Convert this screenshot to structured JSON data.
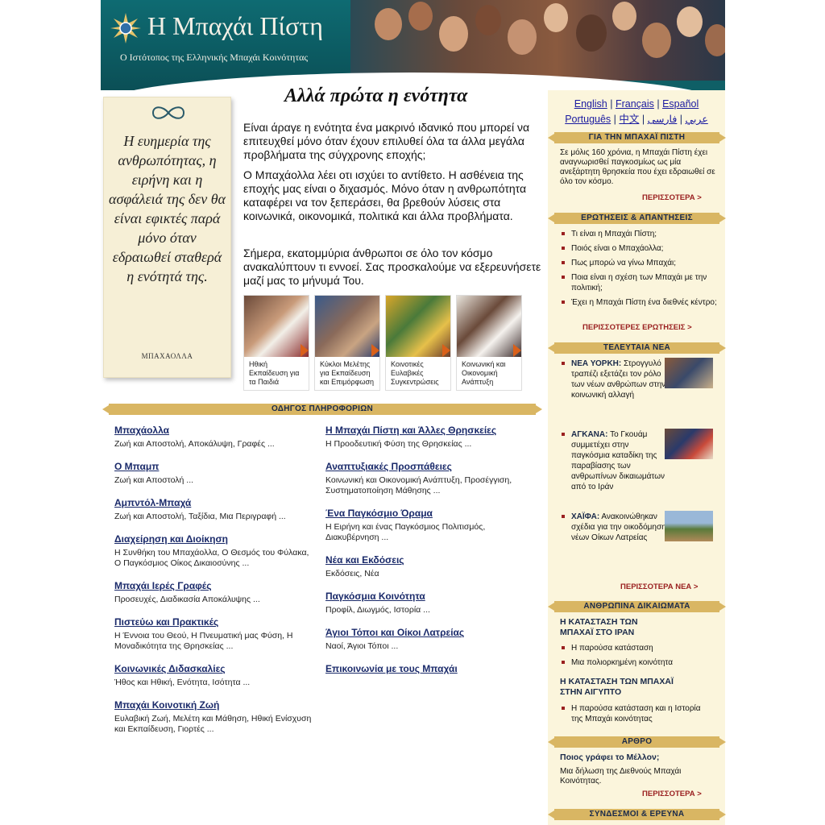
{
  "header": {
    "title": "Η Μπαχάι Πίστη",
    "subtitle": "Ο Ιστότοπος της Ελληνικής Μπαχάι Κοινότητας"
  },
  "quote": {
    "text": "Η ευημερία της ανθρωπότητας, η ειρήνη και η ασφάλειά της δεν θα είναι εφικτές παρά μόνο όταν εδραιωθεί σταθερά η ενότητά της.",
    "author": "ΜΠΑΧΑΟΛΛΑ"
  },
  "main": {
    "title": "Αλλά πρώτα η ενότητα",
    "paragraphs": [
      "Είναι άραγε η ενότητα ένα μακρινό ιδανικό που μπορεί να επιτευχθεί μόνο όταν έχουν επιλυθεί όλα τα άλλα μεγάλα προβλήματα της σύγχρονης εποχής;",
      "Ο Μπαχάολλα λέει οτι ισχύει το αντίθετο. Η ασθένεια της εποχής μας είναι ο διχασμός. Μόνο όταν η ανθρωπότητα καταφέρει να τον ξεπεράσει, θα βρεθούν λύσεις στα κοινωνικά, οικονομικά, πολιτικά και άλλα προβλήματα.",
      "Σήμερα, εκατομμύρια άνθρωποι σε όλο τον κόσμο ανακαλύπτουν τι εννοεί. Σας προσκαλούμε να εξερευνήσετε μαζί μας το μήνυμά Του."
    ],
    "thumbs": [
      {
        "caption": "Ηθική Εκπαίδευση για τα Παιδιά"
      },
      {
        "caption": "Κύκλοι Μελέτης για Εκπαίδευση και Επιμόρφωση"
      },
      {
        "caption": "Κοινοτικές Ευλαβικές Συγκεντρώσεις"
      },
      {
        "caption": "Κοινωνική και Οικονομική Ανάπτυξη"
      }
    ]
  },
  "guide": {
    "bar": "ΟΔΗΓΟΣ ΠΛΗΡΟΦΟΡΙΩΝ",
    "left": [
      {
        "title": "Μπαχάολλα",
        "desc": "Ζωή και Αποστολή, Αποκάλυψη, Γραφές ..."
      },
      {
        "title": "Ο Μπαμπ",
        "desc": "Ζωή και Αποστολή ..."
      },
      {
        "title": "Αμπντόλ-Μπαχά",
        "desc": "Ζωή και Αποστολή, Ταξίδια, Μια Περιγραφή ..."
      },
      {
        "title": "Διαχείρηση και Διοίκηση",
        "desc": "Η Συνθήκη του Μπαχάολλα, Ο Θεσμός του Φύλακα, Ο Παγκόσμιος Οίκος Δικαιοσύνης ..."
      },
      {
        "title": "Μπαχάι Ιερές Γραφές",
        "desc": "Προσευχές, Διαδικασία Αποκάλυψης ..."
      },
      {
        "title": "Πιστεύω και Πρακτικές",
        "desc": "Η Έννοια του Θεού, Η Πνευματική μας Φύση, Η Μοναδικότητα της Θρησκείας ..."
      },
      {
        "title": "Κοινωνικές Διδασκαλίες",
        "desc": "Ήθος και Ηθική, Ενότητα, Ισότητα ..."
      },
      {
        "title": "Μπαχάι Κοινοτική Ζωή",
        "desc": "Ευλαβική Ζωή, Μελέτη και Μάθηση, Ηθική Ενίσχυση και Εκπαίδευση, Γιορτές ..."
      }
    ],
    "right": [
      {
        "title": "Η Μπαχάι Πίστη και Άλλες Θρησκείες",
        "desc": "Η Προοδευτική Φύση της Θρησκείας ..."
      },
      {
        "title": "Αναπτυξιακές Προσπάθειες",
        "desc": "Κοινωνική και Οικονομική Ανάπτυξη, Προσέγγιση, Συστηματοποίηση Μάθησης ..."
      },
      {
        "title": "Ένα Παγκόσμιο Όραμα",
        "desc": "Η Ειρήνη και ένας Παγκόσμιος Πολιτισμός, Διακυβέρνηση ..."
      },
      {
        "title": "Νέα και Εκδόσεις",
        "desc": "Εκδόσεις, Νέα"
      },
      {
        "title": "Παγκόσμια Κοινότητα",
        "desc": "Προφίλ, Διωγμός, Ιστορία ..."
      },
      {
        "title": "Άγιοι Τόποι και Οίκοι Λατρείας",
        "desc": "Ναοί, Άγιοι Τόποι ..."
      },
      {
        "title": "Επικοινωνία με τους Μπαχάι",
        "desc": ""
      }
    ]
  },
  "sidebar": {
    "languages": [
      "English",
      "Français",
      "Español",
      "Português",
      "中文",
      "عربي",
      "فارسی"
    ],
    "about": {
      "bar": "ΓΙΑ ΤΗΝ ΜΠΑΧΑΪ ΠΙΣΤΗ",
      "text": "Σε μόλις 160 χρόνια, η Μπαχάι Πίστη έχει αναγνωρισθεί παγκοσμίως ως μία ανεξάρτητη θρησκεία που έχει εδραιωθεί σε όλο τον κόσμο.",
      "more": "ΠΕΡΙΣΣΟΤΕΡΑ >"
    },
    "faq": {
      "bar": "ΕΡΩΤΗΣΕΙΣ & ΑΠΑΝΤΗΣΕΙΣ",
      "items": [
        "Τι είναι η Μπαχάι Πίστη;",
        "Ποιός είναι ο Μπαχάολλα;",
        "Πως μπορώ να γίνω Μπαχάι;",
        "Ποια είναι η σχέση των Μπαχάι με την πολιτική;",
        "Έχει η Μπαχάι Πίστη ένα διεθνές κέντρο;"
      ],
      "more": "ΠΕΡΙΣΣΟΤΕΡΕΣ ΕΡΩΤΗΣΕΙΣ >"
    },
    "news": {
      "bar": "ΤΕΛΕΥΤΑΙΑ ΝΕΑ",
      "items": [
        {
          "place": "ΝΕΑ ΥΟΡΚΗ:",
          "text": "Στρογγυλό τραπέζι εξετάζει τον ρόλο των νέων ανθρώπων στην κοινωνική αλλαγή"
        },
        {
          "place": "ΑΓΚΑΝΑ:",
          "text": "Το Γκουάμ συμμετέχει στην παγκόσμια καταδίκη της παραβίασης των ανθρωπίνων δικαιωμάτων από το Ιράν"
        },
        {
          "place": "ΧΑΪΦΑ:",
          "text": "Ανακοινώθηκαν σχέδια για την οικοδόμηση νέων Οίκων Λατρείας"
        }
      ],
      "more": "ΠΕΡΙΣΣΟΤΕΡΑ ΝΕΑ >"
    },
    "rights": {
      "bar": "ΑΝΘΡΩΠΙΝΑ ΔΙΚΑΙΩΜΑΤΑ",
      "head1": "Η ΚΑΤΑΣΤΑΣΗ ΤΩΝ ΜΠΑΧΑΪ ΣΤΟ ΙΡΑΝ",
      "items1": [
        "Η παρούσα κατάσταση",
        "Μια πολιορκημένη κοινότητα"
      ],
      "head2": "Η ΚΑΤΑΣΤΑΣΗ ΤΩΝ ΜΠΑΧΑΪ ΣΤΗΝ ΑΙΓΥΠΤΟ",
      "items2": [
        "Η παρούσα κατάσταση και η Ιστορία της Μπαχάι κοινότητας"
      ]
    },
    "article": {
      "bar": "ΑΡΘΡΟ",
      "title": "Ποιος γράφει το Μέλλον;",
      "text": "Μια δήλωση της Διεθνούς Μπαχάι Κοινότητας.",
      "more": "ΠΕΡΙΣΣΟΤΕΡΑ >"
    },
    "links_bar": "ΣΥΝΔΕΣΜΟΙ & ΕΡΕΥΝΑ"
  }
}
